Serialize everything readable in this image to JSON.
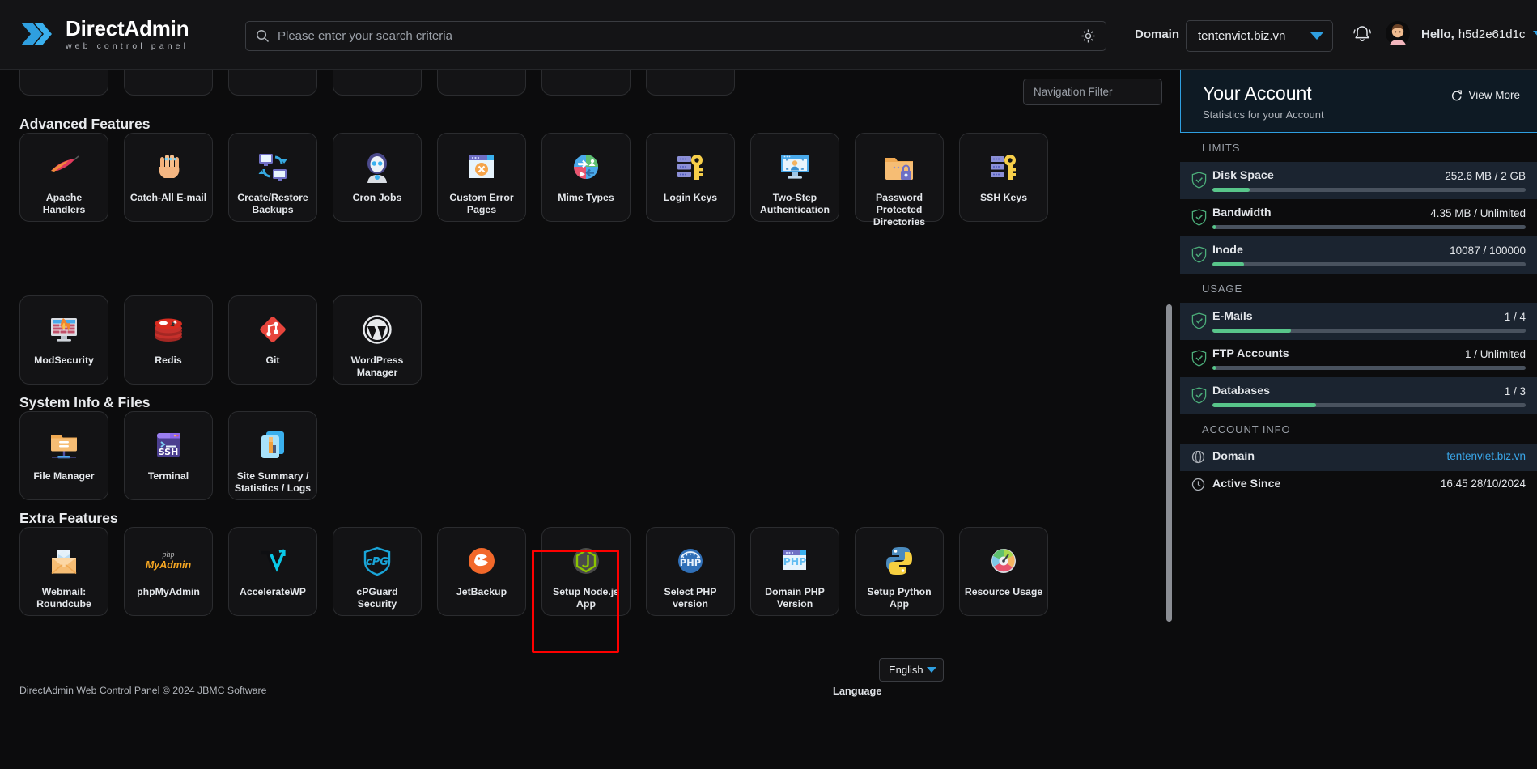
{
  "header": {
    "brand_title_1": "Direct",
    "brand_title_2": "Admin",
    "brand_subtitle": "web control panel",
    "logo_icon": "chevron-double-right-logo",
    "search_icon": "search-icon",
    "search_placeholder": "Please enter your search criteria",
    "search_value": "",
    "search_settings_icon": "gear-icon",
    "domain_label": "Domain",
    "domain_value": "tentenviet.biz.vn",
    "domain_caret_icon": "chevron-down-icon",
    "bell_icon": "notification-bell-icon",
    "avatar_icon": "user-avatar-icon",
    "hello_label": "Hello,",
    "hello_user": "h5d2e61d1c",
    "hello_caret_icon": "chevron-down-icon"
  },
  "nav_filter": {
    "placeholder": "Navigation Filter",
    "value": ""
  },
  "sections": [
    {
      "title": "Advanced Features",
      "rows": [
        [
          {
            "label": "Apache Handlers",
            "icon": "apache-feather-icon"
          },
          {
            "label": "Catch-All E-mail",
            "icon": "hand-catch-icon"
          },
          {
            "label": "Create/Restore Backups",
            "icon": "backup-monitors-icon"
          },
          {
            "label": "Cron Jobs",
            "icon": "robot-icon"
          },
          {
            "label": "Custom Error Pages",
            "icon": "error-page-icon"
          },
          {
            "label": "Mime Types",
            "icon": "mime-types-icon"
          },
          {
            "label": "Login Keys",
            "icon": "server-key-icon"
          },
          {
            "label": "Two-Step Authentication",
            "icon": "two-step-auth-icon"
          },
          {
            "label": "Password Protected Directories",
            "icon": "locked-folder-icon"
          },
          {
            "label": "SSH Keys",
            "icon": "server-key-icon"
          }
        ],
        [
          {
            "label": "ModSecurity",
            "icon": "firewall-monitor-icon"
          },
          {
            "label": "Redis",
            "icon": "redis-icon"
          },
          {
            "label": "Git",
            "icon": "git-icon"
          },
          {
            "label": "WordPress Manager",
            "icon": "wordpress-icon"
          }
        ]
      ]
    },
    {
      "title": "System Info & Files",
      "rows": [
        [
          {
            "label": "File Manager",
            "icon": "file-folder-icon"
          },
          {
            "label": "Terminal",
            "icon": "ssh-terminal-icon"
          },
          {
            "label": "Site Summary / Statistics / Logs",
            "icon": "statistics-icon"
          }
        ]
      ]
    },
    {
      "title": "Extra Features",
      "rows": [
        [
          {
            "label": "Webmail: Roundcube",
            "icon": "roundcube-mail-icon"
          },
          {
            "label": "phpMyAdmin",
            "icon": "phpmyadmin-icon"
          },
          {
            "label": "AccelerateWP",
            "icon": "acceleratewp-icon"
          },
          {
            "label": "cPGuard Security",
            "icon": "cpguard-shield-icon"
          },
          {
            "label": "JetBackup",
            "icon": "jetbackup-icon"
          },
          {
            "label": "Setup Node.js App",
            "icon": "nodejs-icon"
          },
          {
            "label": "Select PHP version",
            "icon": "php-gauge-icon",
            "highlighted": true
          },
          {
            "label": "Domain PHP Version",
            "icon": "php-window-icon"
          },
          {
            "label": "Setup Python App",
            "icon": "python-icon"
          },
          {
            "label": "Resource Usage",
            "icon": "resource-gauge-icon"
          }
        ]
      ]
    }
  ],
  "footer": {
    "copyright": "DirectAdmin Web Control Panel © 2024 JBMC Software",
    "language_label": "Language",
    "language_value": "English",
    "language_caret_icon": "chevron-down-icon"
  },
  "right_panel": {
    "title": "Your Account",
    "subtitle": "Statistics for your Account",
    "view_more_label": "View More",
    "view_more_icon": "refresh-external-icon",
    "limits_label": "LIMITS",
    "usage_label": "USAGE",
    "account_info_label": "ACCOUNT INFO",
    "limits": [
      {
        "name": "Disk Space",
        "value": "252.6 MB / 2 GB",
        "percent": 12,
        "shield_icon": "shield-check-icon"
      },
      {
        "name": "Bandwidth",
        "value": "4.35 MB / Unlimited",
        "percent": 1,
        "shield_icon": "shield-check-icon"
      },
      {
        "name": "Inode",
        "value": "10087 / 100000",
        "percent": 10,
        "shield_icon": "shield-check-icon"
      }
    ],
    "usage": [
      {
        "name": "E-Mails",
        "value": "1 / 4",
        "percent": 25,
        "shield_icon": "shield-check-icon"
      },
      {
        "name": "FTP Accounts",
        "value": "1 / Unlimited",
        "percent": 1,
        "shield_icon": "shield-check-icon"
      },
      {
        "name": "Databases",
        "value": "1 / 3",
        "percent": 33,
        "shield_icon": "shield-check-icon"
      }
    ],
    "account_info": [
      {
        "name": "Domain",
        "value": "tentenviet.biz.vn",
        "icon": "globe-icon",
        "is_link": true
      },
      {
        "name": "Active Since",
        "value": "16:45 28/10/2024",
        "icon": "clock-icon",
        "is_link": false
      }
    ]
  },
  "colors": {
    "accent_blue": "#2f9fe0",
    "highlight_red": "#fe0000",
    "bar_green": "#58c58a",
    "panel_bg": "#0c0c0d",
    "card_bg": "#131315"
  }
}
